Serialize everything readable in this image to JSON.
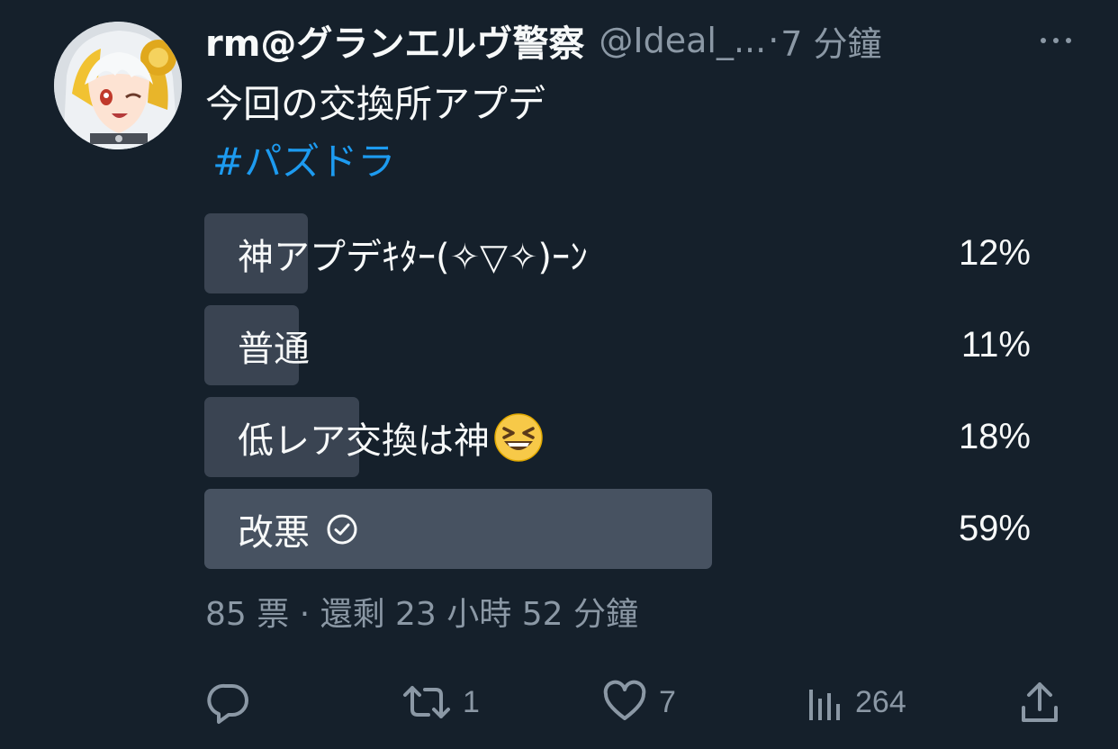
{
  "tweet": {
    "display_name": "rm@グランエルヴ警察",
    "handle": "@Ideal_...",
    "separator": "·",
    "timestamp": "7 分鐘",
    "text": "今回の交換所アプデ",
    "hashtag": "#パズドラ"
  },
  "poll": {
    "options": [
      {
        "label": "神アプデｷﾀｰ(✧▽✧)ｰﾝ",
        "percent_text": "12%",
        "percent": 12
      },
      {
        "label": "普通",
        "percent_text": "11%",
        "percent": 11
      },
      {
        "label": "低レア交換は神",
        "percent_text": "18%",
        "percent": 18
      },
      {
        "label": "改悪",
        "percent_text": "59%",
        "percent": 59
      }
    ],
    "winner_index": 3,
    "meta": "85 票 · 還剩 23 小時 52 分鐘"
  },
  "actions": {
    "reply": {
      "icon": "reply-icon",
      "count": ""
    },
    "retweet": {
      "icon": "retweet-icon",
      "count": "1"
    },
    "like": {
      "icon": "heart-icon",
      "count": "7"
    },
    "views": {
      "icon": "views-icon",
      "count": "264"
    },
    "share": {
      "icon": "share-icon",
      "count": ""
    }
  },
  "colors": {
    "background": "#15202b",
    "text": "#f7f9f9",
    "secondary": "#8b98a5",
    "link": "#1d9bf0",
    "poll_fill": "#3a4452",
    "poll_fill_winner": "#475261"
  }
}
